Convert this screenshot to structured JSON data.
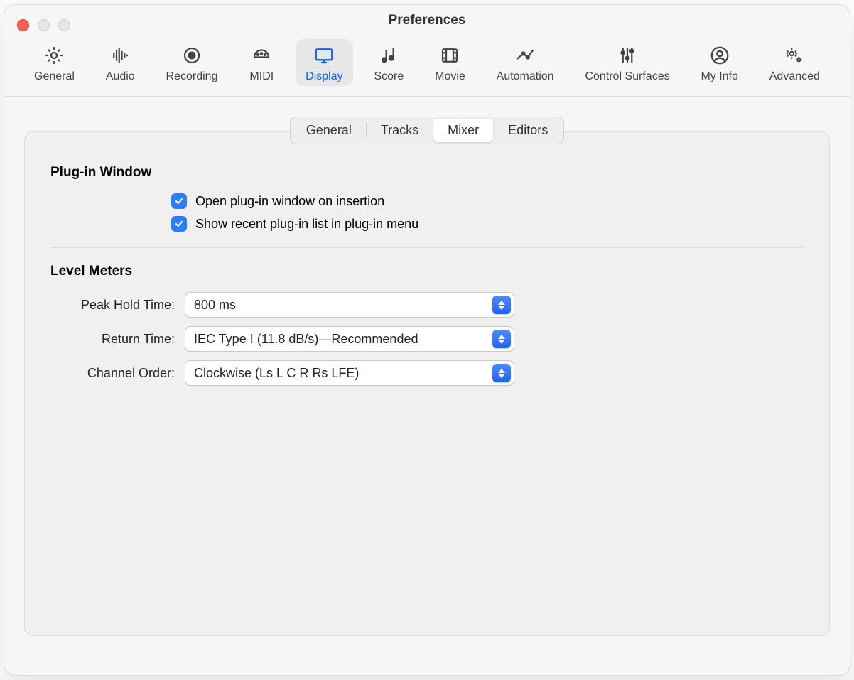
{
  "window": {
    "title": "Preferences"
  },
  "toolbar": {
    "items": [
      {
        "id": "general",
        "label": "General"
      },
      {
        "id": "audio",
        "label": "Audio"
      },
      {
        "id": "recording",
        "label": "Recording"
      },
      {
        "id": "midi",
        "label": "MIDI"
      },
      {
        "id": "display",
        "label": "Display"
      },
      {
        "id": "score",
        "label": "Score"
      },
      {
        "id": "movie",
        "label": "Movie"
      },
      {
        "id": "automation",
        "label": "Automation"
      },
      {
        "id": "control-surfaces",
        "label": "Control Surfaces"
      },
      {
        "id": "my-info",
        "label": "My Info"
      },
      {
        "id": "advanced",
        "label": "Advanced"
      }
    ],
    "selected": "display"
  },
  "subtabs": {
    "items": [
      "General",
      "Tracks",
      "Mixer",
      "Editors"
    ],
    "selected": "Mixer"
  },
  "sections": {
    "plugin_window": {
      "title": "Plug-in Window",
      "checks": [
        {
          "id": "open-on-insert",
          "label": "Open plug-in window on insertion",
          "checked": true
        },
        {
          "id": "show-recent",
          "label": "Show recent plug-in list in plug-in menu",
          "checked": true
        }
      ]
    },
    "level_meters": {
      "title": "Level Meters",
      "fields": {
        "peak_hold": {
          "label": "Peak Hold Time:",
          "value": "800 ms"
        },
        "return_time": {
          "label": "Return Time:",
          "value": "IEC Type I (11.8 dB/s)—Recommended"
        },
        "channel_order": {
          "label": "Channel Order:",
          "value": "Clockwise (Ls L C R Rs LFE)"
        }
      }
    }
  }
}
